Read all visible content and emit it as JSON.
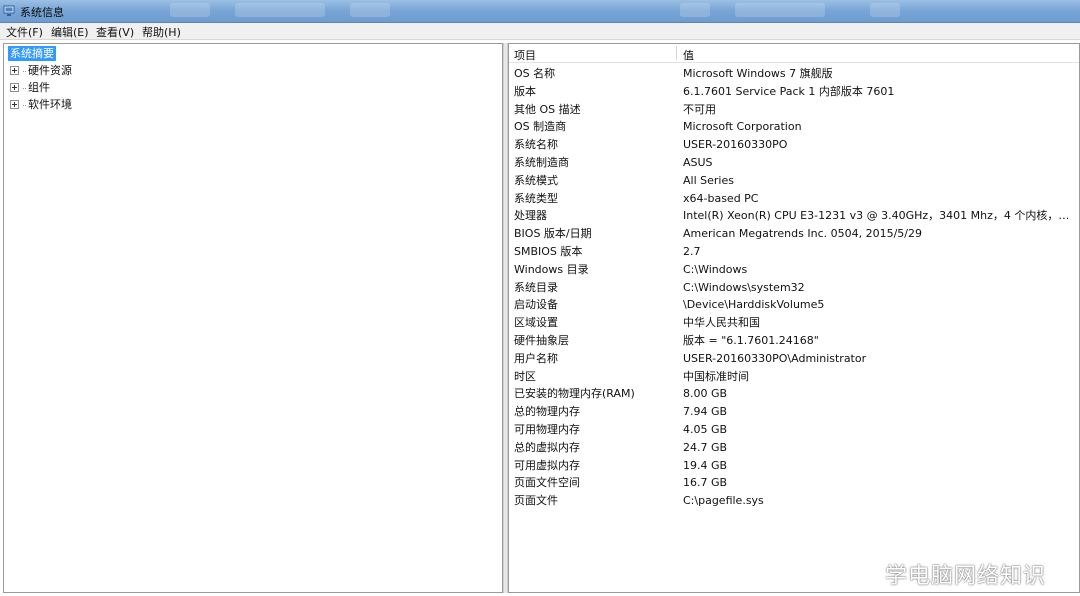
{
  "window": {
    "title": "系统信息"
  },
  "menu": [
    "文件(F)",
    "编辑(E)",
    "查看(V)",
    "帮助(H)"
  ],
  "tree": {
    "selected": "系统摘要",
    "nodes": [
      "硬件资源",
      "组件",
      "软件环境"
    ]
  },
  "table": {
    "headers": {
      "item": "项目",
      "value": "值"
    },
    "rows": [
      {
        "k": "OS 名称",
        "v": "Microsoft Windows 7 旗舰版"
      },
      {
        "k": "版本",
        "v": "6.1.7601 Service Pack 1 内部版本 7601"
      },
      {
        "k": "其他 OS 描述",
        "v": "不可用"
      },
      {
        "k": "OS 制造商",
        "v": "Microsoft Corporation"
      },
      {
        "k": "系统名称",
        "v": "USER-20160330PO"
      },
      {
        "k": "系统制造商",
        "v": "ASUS"
      },
      {
        "k": "系统模式",
        "v": "All Series"
      },
      {
        "k": "系统类型",
        "v": "x64-based PC"
      },
      {
        "k": "处理器",
        "v": "Intel(R) Xeon(R) CPU E3-1231 v3 @ 3.40GHz，3401 Mhz，4 个内核，8 个逻辑处..."
      },
      {
        "k": "BIOS 版本/日期",
        "v": "American Megatrends Inc. 0504, 2015/5/29"
      },
      {
        "k": "SMBIOS 版本",
        "v": "2.7"
      },
      {
        "k": "Windows 目录",
        "v": "C:\\Windows"
      },
      {
        "k": "系统目录",
        "v": "C:\\Windows\\system32"
      },
      {
        "k": "启动设备",
        "v": "\\Device\\HarddiskVolume5"
      },
      {
        "k": "区域设置",
        "v": "中华人民共和国"
      },
      {
        "k": "硬件抽象层",
        "v": "版本 = \"6.1.7601.24168\""
      },
      {
        "k": "用户名称",
        "v": "USER-20160330PO\\Administrator"
      },
      {
        "k": "时区",
        "v": "中国标准时间"
      },
      {
        "k": "已安装的物理内存(RAM)",
        "v": "8.00 GB"
      },
      {
        "k": "总的物理内存",
        "v": "7.94 GB"
      },
      {
        "k": "可用物理内存",
        "v": "4.05 GB"
      },
      {
        "k": "总的虚拟内存",
        "v": "24.7 GB"
      },
      {
        "k": "可用虚拟内存",
        "v": "19.4 GB"
      },
      {
        "k": "页面文件空间",
        "v": "16.7 GB"
      },
      {
        "k": "页面文件",
        "v": "C:\\pagefile.sys"
      }
    ]
  },
  "watermark": {
    "text": "学电脑网络知识",
    "icon": "wechat-icon"
  },
  "colors": {
    "titlebar": "#7aa6d6",
    "selection": "#3399ff",
    "menubar": "#f0f0f0"
  }
}
